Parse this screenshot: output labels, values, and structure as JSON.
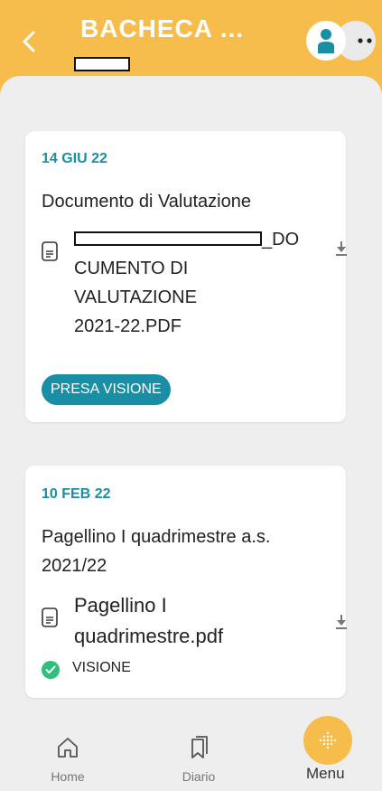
{
  "header": {
    "title": "BACHECA ...",
    "back_icon": "chevron-left-icon",
    "avatar_icon": "user-icon",
    "more_icon": "more-dots-icon",
    "accent_color": "#f7bd4c"
  },
  "cards": [
    {
      "date": "14 GIU 22",
      "title": "Documento di Valutazione",
      "file_name_lines": [
        "_DO",
        "CUMENTO DI",
        "VALUTAZIONE",
        "2021-22.PDF"
      ],
      "action_label": "PRESA VISIONE",
      "file_icon": "document-icon",
      "download_icon": "download-icon"
    },
    {
      "date": "10 FEB 22",
      "title_lines": [
        "Pagellino I quadrimestre a.s.",
        "2021/22"
      ],
      "file_name_lines": [
        "Pagellino I",
        "quadrimestre.pdf"
      ],
      "status_label": "VISIONE",
      "status_icon": "check-circle-icon",
      "file_icon": "document-icon",
      "download_icon": "download-icon"
    }
  ],
  "tabbar": {
    "items": [
      {
        "label": "Home",
        "icon": "home-icon"
      },
      {
        "label": "Diario",
        "icon": "bookmarks-icon"
      },
      {
        "label": "Menu",
        "icon": "grid-dots-icon"
      }
    ]
  },
  "colors": {
    "teal": "#1a8ea5",
    "green_check": "#2ebf7a",
    "background": "#eeeeee"
  }
}
